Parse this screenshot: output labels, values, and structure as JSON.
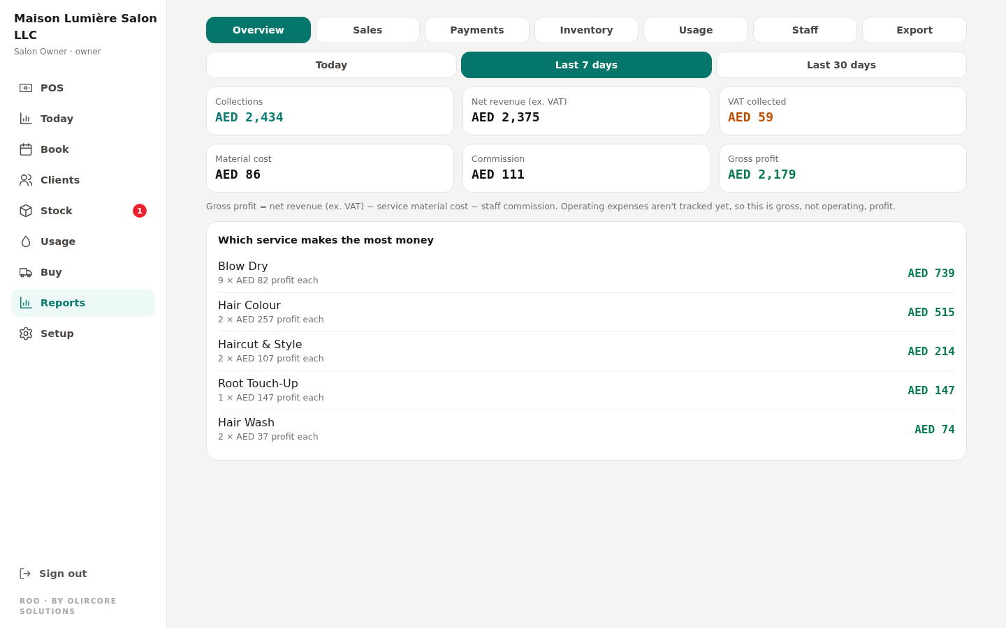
{
  "sidebar": {
    "business_name": "Maison Lumière Salon LLC",
    "user": "Salon Owner · owner",
    "items": [
      {
        "label": "POS",
        "selected": false
      },
      {
        "label": "Today",
        "selected": false
      },
      {
        "label": "Book",
        "selected": false
      },
      {
        "label": "Clients",
        "selected": false
      },
      {
        "label": "Stock",
        "selected": false,
        "badge": "1"
      },
      {
        "label": "Usage",
        "selected": false
      },
      {
        "label": "Buy",
        "selected": false
      },
      {
        "label": "Reports",
        "selected": true
      },
      {
        "label": "Setup",
        "selected": false
      }
    ],
    "sign_out": "Sign out",
    "footer": "ROO · BY OLIRCORE SOLUTIONS"
  },
  "tabs": [
    {
      "label": "Overview",
      "selected": true
    },
    {
      "label": "Sales",
      "selected": false
    },
    {
      "label": "Payments",
      "selected": false
    },
    {
      "label": "Inventory",
      "selected": false
    },
    {
      "label": "Usage",
      "selected": false
    },
    {
      "label": "Staff",
      "selected": false
    },
    {
      "label": "Export",
      "selected": false
    }
  ],
  "ranges": [
    {
      "label": "Today",
      "selected": false
    },
    {
      "label": "Last 7 days",
      "selected": true
    },
    {
      "label": "Last 30 days",
      "selected": false
    }
  ],
  "kpis": [
    {
      "label": "Collections",
      "value": "AED 2,434",
      "color": "#0b7a70"
    },
    {
      "label": "Net revenue (ex. VAT)",
      "value": "AED 2,375",
      "color": "#111111"
    },
    {
      "label": "VAT collected",
      "value": "AED 59",
      "color": "#c24e00"
    },
    {
      "label": "Material cost",
      "value": "AED 86",
      "color": "#111111"
    },
    {
      "label": "Commission",
      "value": "AED 111",
      "color": "#111111"
    },
    {
      "label": "Gross profit",
      "value": "AED 2,179",
      "color": "#0a7a55"
    }
  ],
  "note": "Gross profit = net revenue (ex. VAT) − service material cost − staff commission. Operating expenses aren't tracked yet, so this is gross, not operating, profit.",
  "services": {
    "title": "Which service makes the most money",
    "rows": [
      {
        "name": "Blow Dry",
        "detail": "9 × AED 82 profit each",
        "profit": "AED 739"
      },
      {
        "name": "Hair Colour",
        "detail": "2 × AED 257 profit each",
        "profit": "AED 515"
      },
      {
        "name": "Haircut & Style",
        "detail": "2 × AED 107 profit each",
        "profit": "AED 214"
      },
      {
        "name": "Root Touch-Up",
        "detail": "1 × AED 147 profit each",
        "profit": "AED 147"
      },
      {
        "name": "Hair Wash",
        "detail": "2 × AED 37 profit each",
        "profit": "AED 74"
      }
    ]
  }
}
